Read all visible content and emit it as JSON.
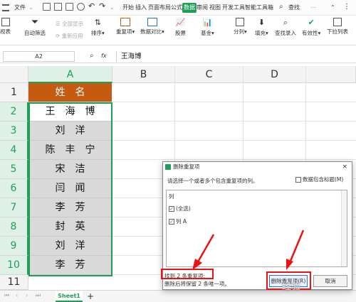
{
  "menubar": {
    "items": [
      "文件",
      "开始",
      "插入",
      "页面布局",
      "公式",
      "数据",
      "审阅",
      "视图",
      "开发工具",
      "智能工具箱"
    ],
    "active": "数据",
    "search": "查找"
  },
  "ribbon": {
    "left_partial": "视表",
    "filter": "自动筛选",
    "show_all": "全部显示",
    "reapply": "重新应用",
    "sort": "排序",
    "duplicates": "重复项",
    "compare": "数据对比",
    "stocks": "股票",
    "fund": "基金",
    "split": "分列",
    "fill": "填充",
    "lookup": "查找录入",
    "validity": "有效性",
    "dropdown": "下拉列表"
  },
  "formula_bar": {
    "name_box": "A2",
    "fx": "fx",
    "value": "王海博"
  },
  "sheet": {
    "columns": [
      "A",
      "B",
      "C",
      "D"
    ],
    "rows": [
      "1",
      "2",
      "3",
      "4",
      "5",
      "6",
      "7",
      "8",
      "9",
      "10",
      "11"
    ],
    "cells": [
      "姓名",
      "王海博",
      "刘洋",
      "陈丰宁",
      "宋洁",
      "闫闻",
      "李芳",
      "封英",
      "刘洋",
      "李芳"
    ],
    "tab": "Sheet1"
  },
  "dialog": {
    "title": "删除重复项",
    "close": "×",
    "description": "请选择一个或者多个包含重复项的列。",
    "header_checkbox": "数据包含标题(M)",
    "list_header": "列",
    "select_all": "(全选)",
    "column_a": "列 A",
    "found": "找到 2 条重复项;",
    "note": "删除后将保留 2 条唯一项。",
    "delete_button": "删除重复项(R)",
    "cancel_button": "取消"
  },
  "colors": {
    "accent": "#1e9e59",
    "header_fill": "#c55a11",
    "cell_fill": "#d9d9d9",
    "annotation": "#ee1111"
  },
  "watermark": "经验"
}
